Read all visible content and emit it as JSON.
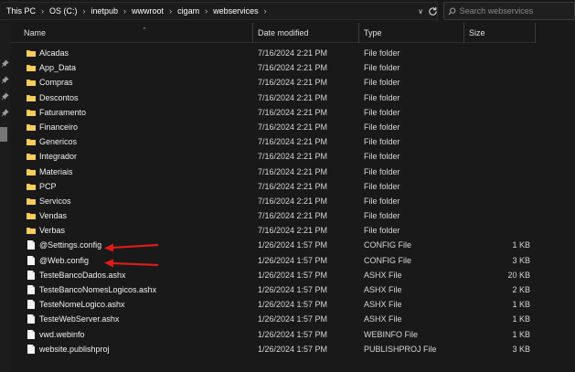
{
  "breadcrumb": [
    {
      "label": "This PC"
    },
    {
      "label": "OS (C:)"
    },
    {
      "label": "inetpub"
    },
    {
      "label": "wwwroot"
    },
    {
      "label": "cigam"
    },
    {
      "label": "webservices"
    }
  ],
  "search": {
    "placeholder": "Search webservices"
  },
  "columns": {
    "name": "Name",
    "date": "Date modified",
    "type": "Type",
    "size": "Size"
  },
  "files": [
    {
      "name": "Alcadas",
      "date": "7/16/2024 2:21 PM",
      "type": "File folder",
      "size": "",
      "icon": "folder-icon"
    },
    {
      "name": "App_Data",
      "date": "7/16/2024 2:21 PM",
      "type": "File folder",
      "size": "",
      "icon": "folder-icon"
    },
    {
      "name": "Compras",
      "date": "7/16/2024 2:21 PM",
      "type": "File folder",
      "size": "",
      "icon": "folder-icon"
    },
    {
      "name": "Descontos",
      "date": "7/16/2024 2:21 PM",
      "type": "File folder",
      "size": "",
      "icon": "folder-icon"
    },
    {
      "name": "Faturamento",
      "date": "7/16/2024 2:21 PM",
      "type": "File folder",
      "size": "",
      "icon": "folder-icon"
    },
    {
      "name": "Financeiro",
      "date": "7/16/2024 2:21 PM",
      "type": "File folder",
      "size": "",
      "icon": "folder-icon"
    },
    {
      "name": "Genericos",
      "date": "7/16/2024 2:21 PM",
      "type": "File folder",
      "size": "",
      "icon": "folder-icon"
    },
    {
      "name": "Integrador",
      "date": "7/16/2024 2:21 PM",
      "type": "File folder",
      "size": "",
      "icon": "folder-icon"
    },
    {
      "name": "Materiais",
      "date": "7/16/2024 2:21 PM",
      "type": "File folder",
      "size": "",
      "icon": "folder-icon"
    },
    {
      "name": "PCP",
      "date": "7/16/2024 2:21 PM",
      "type": "File folder",
      "size": "",
      "icon": "folder-icon"
    },
    {
      "name": "Servicos",
      "date": "7/16/2024 2:21 PM",
      "type": "File folder",
      "size": "",
      "icon": "folder-icon"
    },
    {
      "name": "Vendas",
      "date": "7/16/2024 2:21 PM",
      "type": "File folder",
      "size": "",
      "icon": "folder-icon"
    },
    {
      "name": "Verbas",
      "date": "7/16/2024 2:21 PM",
      "type": "File folder",
      "size": "",
      "icon": "folder-icon"
    },
    {
      "name": "@Settings.config",
      "date": "1/26/2024 1:57 PM",
      "type": "CONFIG File",
      "size": "1 KB",
      "icon": "file-icon"
    },
    {
      "name": "@Web.config",
      "date": "1/26/2024 1:57 PM",
      "type": "CONFIG File",
      "size": "3 KB",
      "icon": "file-icon"
    },
    {
      "name": "TesteBancoDados.ashx",
      "date": "1/26/2024 1:57 PM",
      "type": "ASHX File",
      "size": "20 KB",
      "icon": "file-icon"
    },
    {
      "name": "TesteBancoNomesLogicos.ashx",
      "date": "1/26/2024 1:57 PM",
      "type": "ASHX File",
      "size": "2 KB",
      "icon": "file-icon"
    },
    {
      "name": "TesteNomeLogico.ashx",
      "date": "1/26/2024 1:57 PM",
      "type": "ASHX File",
      "size": "1 KB",
      "icon": "file-icon"
    },
    {
      "name": "TesteWebServer.ashx",
      "date": "1/26/2024 1:57 PM",
      "type": "ASHX File",
      "size": "1 KB",
      "icon": "file-icon"
    },
    {
      "name": "vwd.webinfo",
      "date": "1/26/2024 1:57 PM",
      "type": "WEBINFO File",
      "size": "1 KB",
      "icon": "file-icon"
    },
    {
      "name": "website.publishproj",
      "date": "1/26/2024 1:57 PM",
      "type": "PUBLISHPROJ File",
      "size": "3 KB",
      "icon": "file-icon"
    }
  ],
  "annotations": {
    "arrow_color": "#e01b1b",
    "highlighted_files": [
      "@Settings.config",
      "@Web.config"
    ]
  },
  "colors": {
    "background": "#191919",
    "folder": "#f2c14e",
    "text": "#f0f0f0"
  }
}
